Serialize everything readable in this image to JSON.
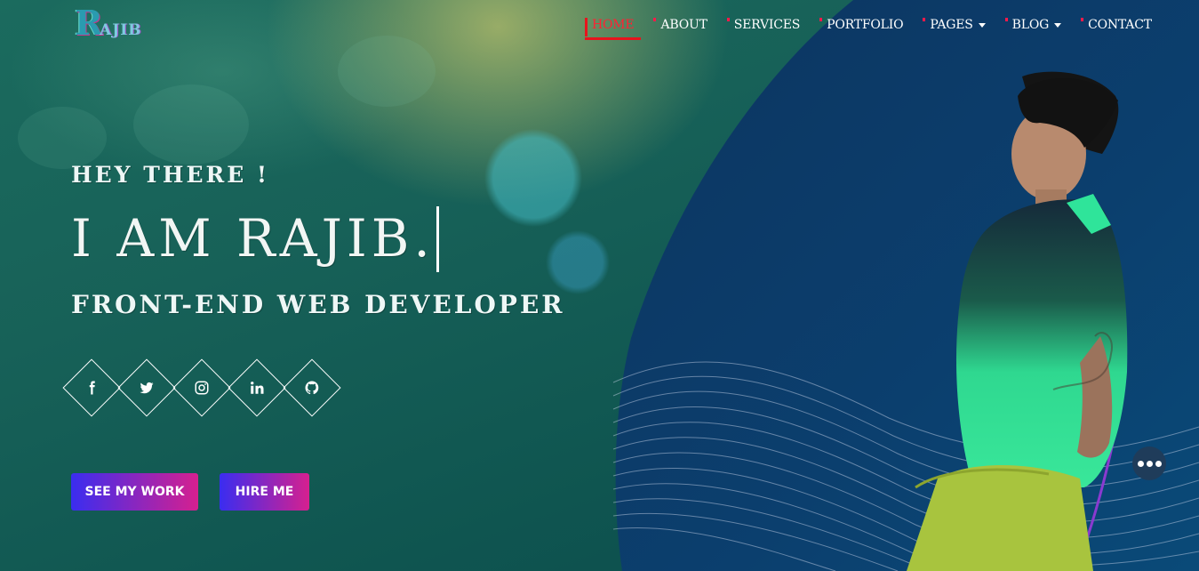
{
  "logo": {
    "mark": "R",
    "text": "AJIB"
  },
  "nav": {
    "items": [
      {
        "label": "HOME",
        "active": true,
        "dropdown": false
      },
      {
        "label": "ABOUT",
        "active": false,
        "dropdown": false
      },
      {
        "label": "SERVICES",
        "active": false,
        "dropdown": false
      },
      {
        "label": "PORTFOLIO",
        "active": false,
        "dropdown": false
      },
      {
        "label": "PAGES",
        "active": false,
        "dropdown": true
      },
      {
        "label": "BLOG",
        "active": false,
        "dropdown": true
      },
      {
        "label": "CONTACT",
        "active": false,
        "dropdown": false
      }
    ]
  },
  "hero": {
    "greeting": "HEY THERE !",
    "name": "I AM RAJIB.",
    "role": "FRONT-END WEB DEVELOPER"
  },
  "socials": [
    {
      "icon": "facebook-icon"
    },
    {
      "icon": "twitter-icon"
    },
    {
      "icon": "instagram-icon"
    },
    {
      "icon": "linkedin-icon"
    },
    {
      "icon": "github-icon"
    }
  ],
  "buttons": {
    "work": "SEE MY WORK",
    "hire": "HIRE ME"
  },
  "colors": {
    "accent": "#e8141d",
    "button_start": "#3a2df0",
    "button_end": "#d6208f",
    "panel": "#0b3a66"
  }
}
